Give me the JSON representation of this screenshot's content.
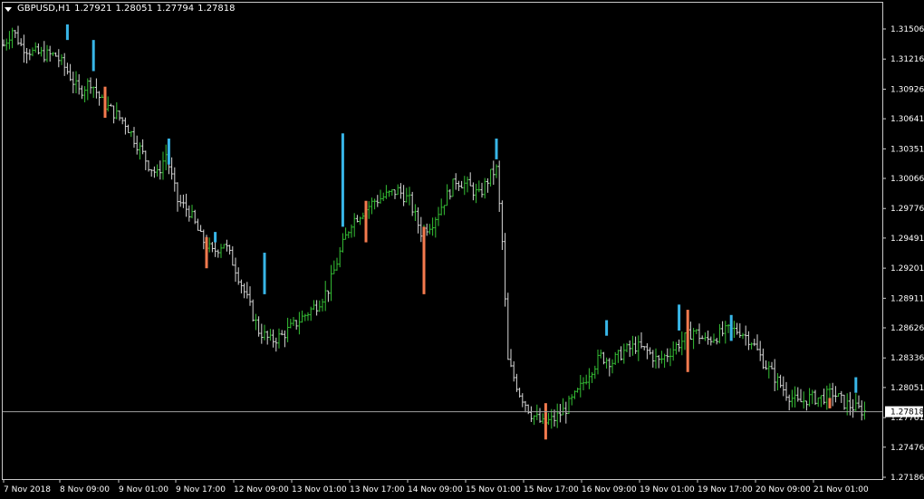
{
  "header": {
    "symbol": "GBPUSD,H1",
    "open": "1.27921",
    "high": "1.28051",
    "low": "1.27794",
    "close": "1.27818"
  },
  "chart_data": {
    "type": "candlestick",
    "title": "GBPUSD,H1",
    "ylim": [
      1.2705,
      1.3175
    ],
    "y_ticks": [
      "1.31506",
      "1.31216",
      "1.30926",
      "1.30641",
      "1.30351",
      "1.30066",
      "1.29776",
      "1.29491",
      "1.29201",
      "1.28911",
      "1.28626",
      "1.28336",
      "1.28051",
      "1.27761",
      "1.27476",
      "1.27186"
    ],
    "x_ticks": [
      "7 Nov 2018",
      "8 Nov 09:00",
      "9 Nov 01:00",
      "9 Nov 17:00",
      "12 Nov 09:00",
      "13 Nov 01:00",
      "13 Nov 17:00",
      "14 Nov 09:00",
      "15 Nov 01:00",
      "15 Nov 17:00",
      "16 Nov 09:00",
      "19 Nov 01:00",
      "19 Nov 17:00",
      "20 Nov 09:00",
      "21 Nov 01:00"
    ],
    "current_price": "1.27818",
    "colors": {
      "bull_bar": "#38b6e8",
      "bear_bar": "#f47a4e",
      "wick_up": "#35c135",
      "wick_down": "#d8d8d8",
      "price_line": "#a0a0a0",
      "price_label_bg": "#ffffff"
    },
    "anchors": [
      [
        0,
        1.3135
      ],
      [
        3,
        1.315
      ],
      [
        6,
        1.3135
      ],
      [
        10,
        1.3128
      ],
      [
        14,
        1.3126
      ],
      [
        18,
        1.3125
      ],
      [
        22,
        1.311
      ],
      [
        26,
        1.309
      ],
      [
        30,
        1.31
      ],
      [
        34,
        1.308
      ],
      [
        38,
        1.307
      ],
      [
        42,
        1.306
      ],
      [
        46,
        1.304
      ],
      [
        50,
        1.302
      ],
      [
        53,
        1.301
      ],
      [
        56,
        1.303
      ],
      [
        60,
        1.2985
      ],
      [
        64,
        1.2975
      ],
      [
        68,
        1.295
      ],
      [
        72,
        1.2935
      ],
      [
        76,
        1.2945
      ],
      [
        80,
        1.292
      ],
      [
        84,
        1.289
      ],
      [
        88,
        1.286
      ],
      [
        92,
        1.285
      ],
      [
        96,
        1.2855
      ],
      [
        100,
        1.2865
      ],
      [
        104,
        1.2875
      ],
      [
        108,
        1.2885
      ],
      [
        112,
        1.29
      ],
      [
        116,
        1.2935
      ],
      [
        120,
        1.2965
      ],
      [
        124,
        1.2975
      ],
      [
        128,
        1.2985
      ],
      [
        132,
        1.299
      ],
      [
        136,
        1.2995
      ],
      [
        140,
        1.2985
      ],
      [
        144,
        1.2955
      ],
      [
        148,
        1.2965
      ],
      [
        152,
        1.2985
      ],
      [
        156,
        1.3005
      ],
      [
        160,
        1.3
      ],
      [
        164,
        1.299
      ],
      [
        168,
        1.301
      ],
      [
        170,
        1.3015
      ],
      [
        172,
        1.2945
      ],
      [
        174,
        1.283
      ],
      [
        178,
        1.28
      ],
      [
        182,
        1.278
      ],
      [
        186,
        1.277
      ],
      [
        190,
        1.2775
      ],
      [
        194,
        1.2785
      ],
      [
        198,
        1.28
      ],
      [
        202,
        1.282
      ],
      [
        206,
        1.2835
      ],
      [
        210,
        1.283
      ],
      [
        214,
        1.284
      ],
      [
        218,
        1.2845
      ],
      [
        222,
        1.284
      ],
      [
        226,
        1.283
      ],
      [
        230,
        1.284
      ],
      [
        234,
        1.285
      ],
      [
        238,
        1.286
      ],
      [
        242,
        1.285
      ],
      [
        246,
        1.2855
      ],
      [
        250,
        1.286
      ],
      [
        254,
        1.286
      ],
      [
        258,
        1.285
      ],
      [
        262,
        1.283
      ],
      [
        266,
        1.2815
      ],
      [
        270,
        1.28
      ],
      [
        274,
        1.279
      ],
      [
        278,
        1.2795
      ],
      [
        282,
        1.2795
      ],
      [
        286,
        1.28
      ],
      [
        290,
        1.279
      ],
      [
        294,
        1.2785
      ],
      [
        297,
        1.2782
      ]
    ],
    "colored_bars": [
      {
        "x": 22,
        "open": 1.314,
        "close": 1.3155,
        "color": "bull"
      },
      {
        "x": 31,
        "open": 1.311,
        "close": 1.314,
        "color": "bull"
      },
      {
        "x": 35,
        "open": 1.3095,
        "close": 1.3065,
        "color": "bear"
      },
      {
        "x": 57,
        "open": 1.302,
        "close": 1.3045,
        "color": "bull"
      },
      {
        "x": 70,
        "open": 1.295,
        "close": 1.292,
        "color": "bear"
      },
      {
        "x": 73,
        "open": 1.2945,
        "close": 1.2955,
        "color": "bull"
      },
      {
        "x": 90,
        "open": 1.2895,
        "close": 1.2935,
        "color": "bull"
      },
      {
        "x": 117,
        "open": 1.296,
        "close": 1.305,
        "color": "bull"
      },
      {
        "x": 125,
        "open": 1.2985,
        "close": 1.2945,
        "color": "bear"
      },
      {
        "x": 145,
        "open": 1.296,
        "close": 1.2895,
        "color": "bear"
      },
      {
        "x": 170,
        "open": 1.3025,
        "close": 1.3045,
        "color": "bull"
      },
      {
        "x": 187,
        "open": 1.279,
        "close": 1.2755,
        "color": "bear"
      },
      {
        "x": 208,
        "open": 1.2855,
        "close": 1.287,
        "color": "bull"
      },
      {
        "x": 233,
        "open": 1.286,
        "close": 1.2885,
        "color": "bull"
      },
      {
        "x": 236,
        "open": 1.288,
        "close": 1.282,
        "color": "bear"
      },
      {
        "x": 251,
        "open": 1.285,
        "close": 1.2875,
        "color": "bull"
      },
      {
        "x": 285,
        "open": 1.2795,
        "close": 1.2785,
        "color": "bear"
      },
      {
        "x": 294,
        "open": 1.28,
        "close": 1.2815,
        "color": "bull"
      }
    ]
  }
}
